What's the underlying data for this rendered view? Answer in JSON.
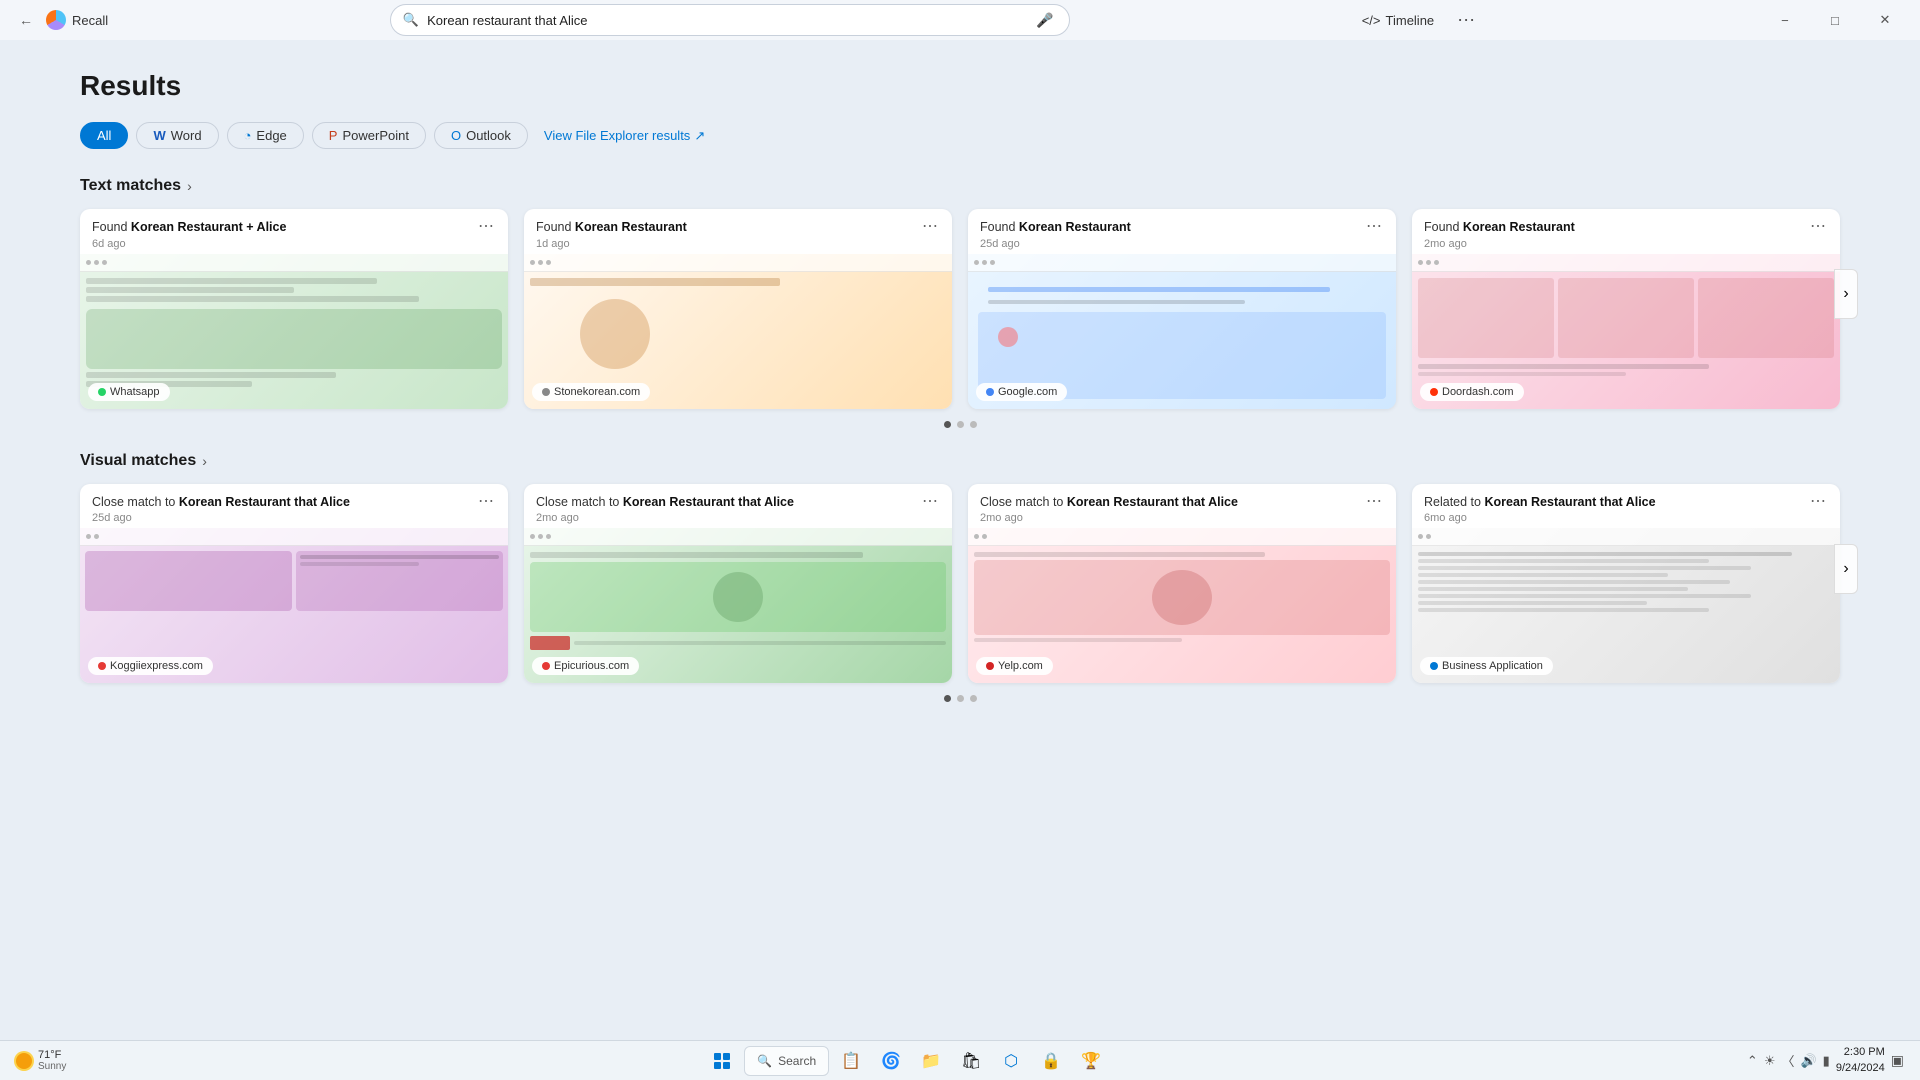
{
  "titleBar": {
    "appName": "Recall",
    "searchQuery": "Korean restaurant that Alice",
    "timelineLabel": "Timeline",
    "micTitle": "Voice input",
    "dotsTitle": "More options",
    "minimize": "−",
    "maximize": "□",
    "close": "✕"
  },
  "results": {
    "heading": "Results"
  },
  "filterTabs": [
    {
      "id": "all",
      "label": "All",
      "active": true,
      "icon": null
    },
    {
      "id": "word",
      "label": "Word",
      "active": false,
      "icon": "W"
    },
    {
      "id": "edge",
      "label": "Edge",
      "active": false,
      "icon": "e"
    },
    {
      "id": "powerpoint",
      "label": "PowerPoint",
      "active": false,
      "icon": "P"
    },
    {
      "id": "outlook",
      "label": "Outlook",
      "active": false,
      "icon": "O"
    },
    {
      "id": "explorer",
      "label": "View File Explorer results",
      "active": false,
      "icon": "↗"
    }
  ],
  "textMatches": {
    "sectionTitle": "Text matches",
    "chevron": "›",
    "cards": [
      {
        "id": "tm1",
        "title": "Found Korean Restaurant + Alice",
        "age": "6d ago",
        "source": "Whatsapp",
        "sourceColor": "#25d366",
        "theme": "whatsapp"
      },
      {
        "id": "tm2",
        "title": "Found Korean Restaurant",
        "age": "1d ago",
        "source": "Stonekorean.com",
        "sourceColor": "#888",
        "theme": "stone"
      },
      {
        "id": "tm3",
        "title": "Found Korean Restaurant",
        "age": "25d ago",
        "source": "Google.com",
        "sourceColor": "#4285f4",
        "theme": "google"
      },
      {
        "id": "tm4",
        "title": "Found Korean Restaurant",
        "age": "2mo ago",
        "source": "Doordash.com",
        "sourceColor": "#ff3008",
        "theme": "doordash"
      }
    ],
    "pagination": [
      true,
      false,
      false
    ]
  },
  "visualMatches": {
    "sectionTitle": "Visual matches",
    "chevron": "›",
    "cards": [
      {
        "id": "vm1",
        "title": "Close match to Korean Restaurant that Alice",
        "age": "25d ago",
        "source": "Koggiiexpress.com",
        "sourceColor": "#e53935",
        "theme": "koggi"
      },
      {
        "id": "vm2",
        "title": "Close match to Korean Restaurant that Alice",
        "age": "2mo ago",
        "source": "Epicurious.com",
        "sourceColor": "#e53935",
        "theme": "epic"
      },
      {
        "id": "vm3",
        "title": "Close match to Korean Restaurant that Alice",
        "age": "2mo ago",
        "source": "Yelp.com",
        "sourceColor": "#d32323",
        "theme": "yelp"
      },
      {
        "id": "vm4",
        "title": "Related to Korean Restaurant that Alice",
        "age": "6mo ago",
        "source": "Business Application",
        "sourceColor": "#0078d4",
        "theme": "biz"
      }
    ],
    "pagination": [
      true,
      false,
      false
    ]
  },
  "taskbar": {
    "weather": {
      "temp": "71°F",
      "condition": "Sunny"
    },
    "searchPlaceholder": "Search",
    "clock": {
      "time": "2:30 PM",
      "date": "9/24/2024"
    },
    "icons": [
      "🗂",
      "🦊",
      "📁",
      "🛍",
      "🌐",
      "🔒",
      "🏆"
    ]
  }
}
